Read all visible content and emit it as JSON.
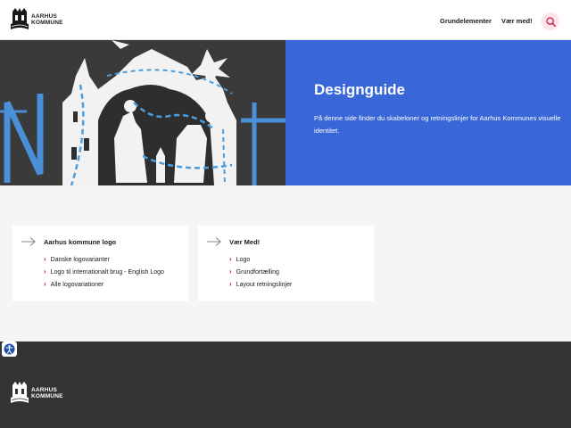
{
  "header": {
    "logo": {
      "line1": "AARHUS",
      "line2": "KOMMUNE"
    },
    "nav": [
      "Grundelementer",
      "Vær med!"
    ],
    "search_icon": "search-icon"
  },
  "hero": {
    "title": "Designguide",
    "description": "På denne side finder du skabeloner og retningslinjer for Aarhus Kommunes visuelle identitet."
  },
  "cards": [
    {
      "title": "Aarhus kommune logo",
      "links": [
        "Danske logovarianter",
        "Logo til internationalt brug - English Logo",
        "Alle logovariationer"
      ]
    },
    {
      "title": "Vær Med!",
      "links": [
        "Logo",
        "Grundfortælling",
        "Layout retningslinjer"
      ]
    }
  ],
  "footer": {
    "logo": {
      "line1": "AARHUS",
      "line2": "KOMMUNE"
    }
  },
  "colors": {
    "accent_blue": "#3a67d8",
    "footer_dark": "#333333",
    "chevron_red": "#c41e3a",
    "search_bg": "#fbe3ea"
  }
}
